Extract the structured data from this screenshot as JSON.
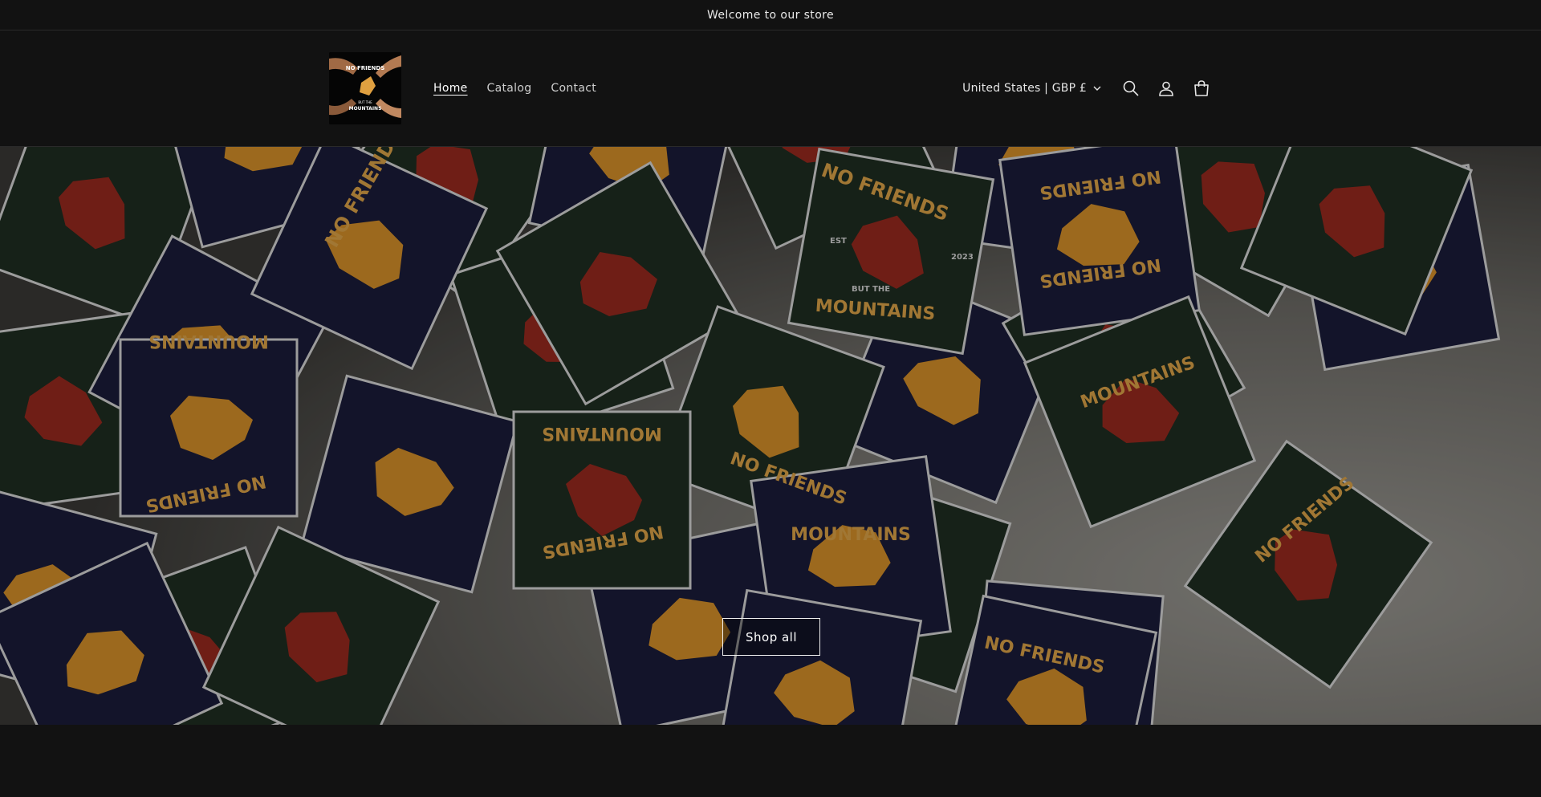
{
  "announcement": {
    "text": "Welcome to our store"
  },
  "header": {
    "logo": {
      "alt_lines": [
        "NO FRIENDS",
        "BUT THE",
        "MOUNTAINS"
      ]
    },
    "nav": [
      {
        "label": "Home",
        "active": true
      },
      {
        "label": "Catalog",
        "active": false
      },
      {
        "label": "Contact",
        "active": false
      }
    ],
    "country_selector": {
      "label": "United States | GBP £",
      "icon": "chevron-down-icon"
    },
    "icons": [
      "search-icon",
      "account-icon",
      "cart-icon"
    ]
  },
  "hero": {
    "button_label": "Shop all",
    "sticker_text": {
      "top": "NO FRIENDS",
      "middle": "BUT THE",
      "bottom": "MOUNTAINS",
      "est": "EST",
      "year": "2023"
    },
    "colors": {
      "navy": "#1b1d3b",
      "forest": "#1f2e22",
      "orange": "#d9922a",
      "red": "#9a2a1f",
      "table": "#7c7a74"
    }
  }
}
